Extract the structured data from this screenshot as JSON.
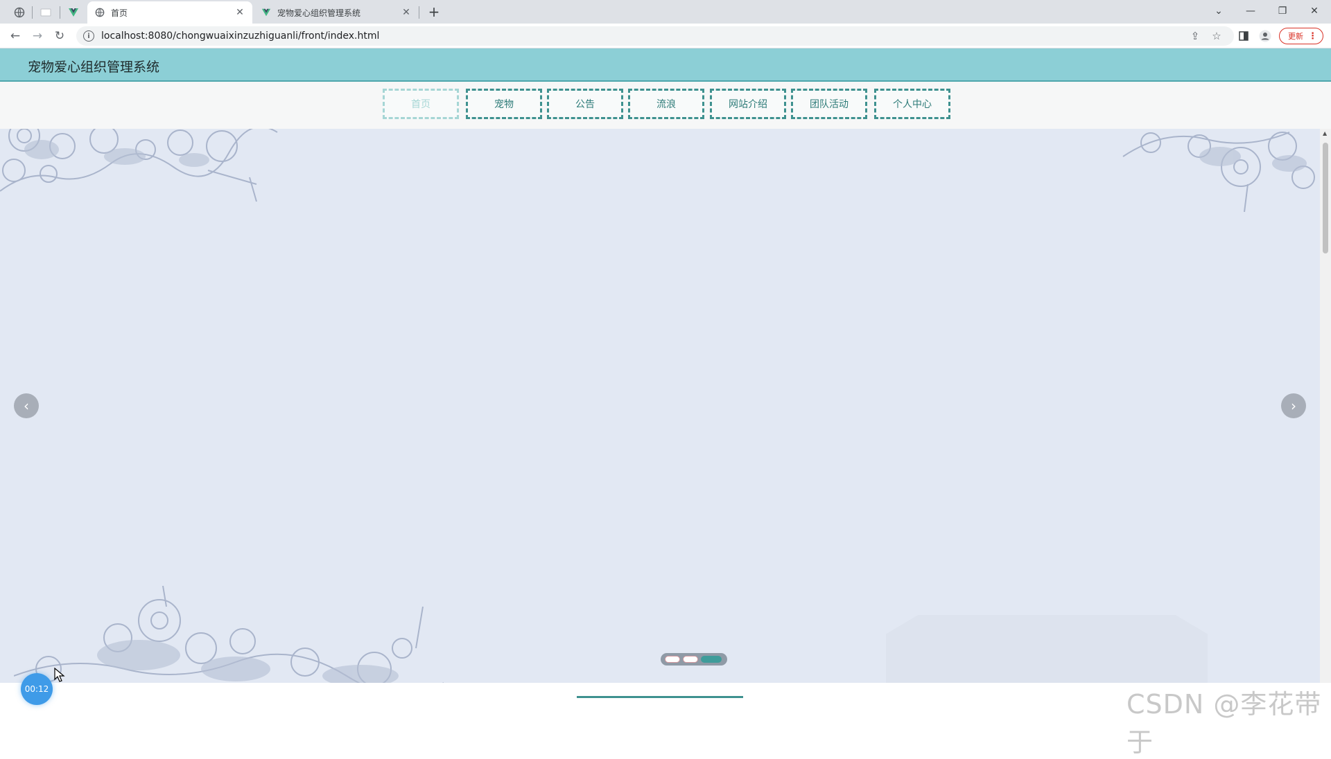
{
  "browser": {
    "tabs": [
      {
        "title": "首页",
        "active": true
      },
      {
        "title": "宠物爱心组织管理系统",
        "active": false
      }
    ],
    "url": "localhost:8080/chongwuaixinzuzhiguanli/front/index.html",
    "update_label": "更新"
  },
  "site": {
    "title": "宠物爱心组织管理系统",
    "menu": [
      "首页",
      "宠物",
      "公告",
      "流浪",
      "网站介绍",
      "团队活动",
      "个人中心"
    ],
    "active_menu": "首页"
  },
  "carousel": {
    "slide_count": 3,
    "active_index": 3
  },
  "overlay": {
    "timer": "00:12",
    "watermark": "CSDN @李花带于"
  },
  "colors": {
    "header_bg": "#8ccfd6",
    "menu_border": "#3e918f",
    "banner_bg": "#e2e8f3"
  }
}
